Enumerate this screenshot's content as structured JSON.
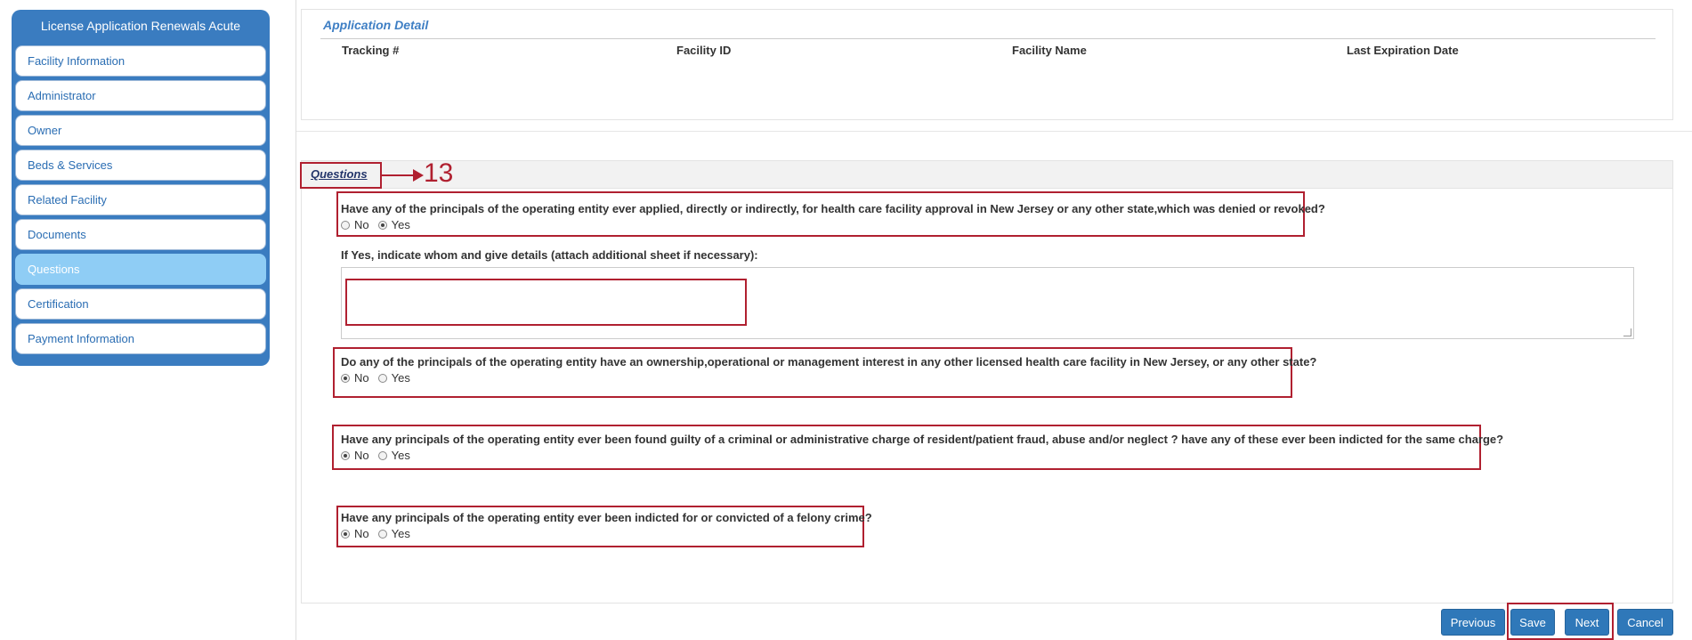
{
  "sidebar": {
    "title": "License Application Renewals Acute",
    "items": [
      {
        "label": "Facility Information"
      },
      {
        "label": "Administrator"
      },
      {
        "label": "Owner"
      },
      {
        "label": "Beds & Services"
      },
      {
        "label": "Related Facility"
      },
      {
        "label": "Documents"
      },
      {
        "label": "Questions"
      },
      {
        "label": "Certification"
      },
      {
        "label": "Payment Information"
      }
    ]
  },
  "application_detail": {
    "title": "Application Detail",
    "columns": [
      "Tracking #",
      "Facility ID",
      "Facility Name",
      "Last Expiration Date"
    ]
  },
  "questions": {
    "title": "Questions",
    "annotation_number": "13",
    "q1": {
      "text": "Have any of the principals of the operating entity ever applied, directly or indirectly, for health care facility approval in New Jersey or any other state,which was denied or revoked?",
      "no": "No",
      "yes": "Yes",
      "selected": "Yes"
    },
    "details_label": "If Yes, indicate whom and give details (attach additional sheet if necessary):",
    "details_value": "",
    "q2": {
      "text": "Do any of the principals of the operating entity have an ownership,operational or management interest in any other licensed health care facility in New Jersey, or any other state?",
      "no": "No",
      "yes": "Yes",
      "selected": "No"
    },
    "q3": {
      "text": "Have any principals of the operating entity ever been found guilty of a criminal or administrative charge of resident/patient fraud, abuse and/or neglect ? have any of these ever been indicted for the same charge?",
      "no": "No",
      "yes": "Yes",
      "selected": "No"
    },
    "q4": {
      "text": "Have any principals of the operating entity ever been indicted for or convicted of a felony crime?",
      "no": "No",
      "yes": "Yes",
      "selected": "No"
    }
  },
  "buttons": {
    "previous": "Previous",
    "save": "Save",
    "next": "Next",
    "cancel": "Cancel"
  },
  "colors": {
    "sidebar_bg": "#3a7cc0",
    "active_item": "#8fcdf5",
    "button_bg": "#2f78b9",
    "annotation_red": "#b02030"
  }
}
